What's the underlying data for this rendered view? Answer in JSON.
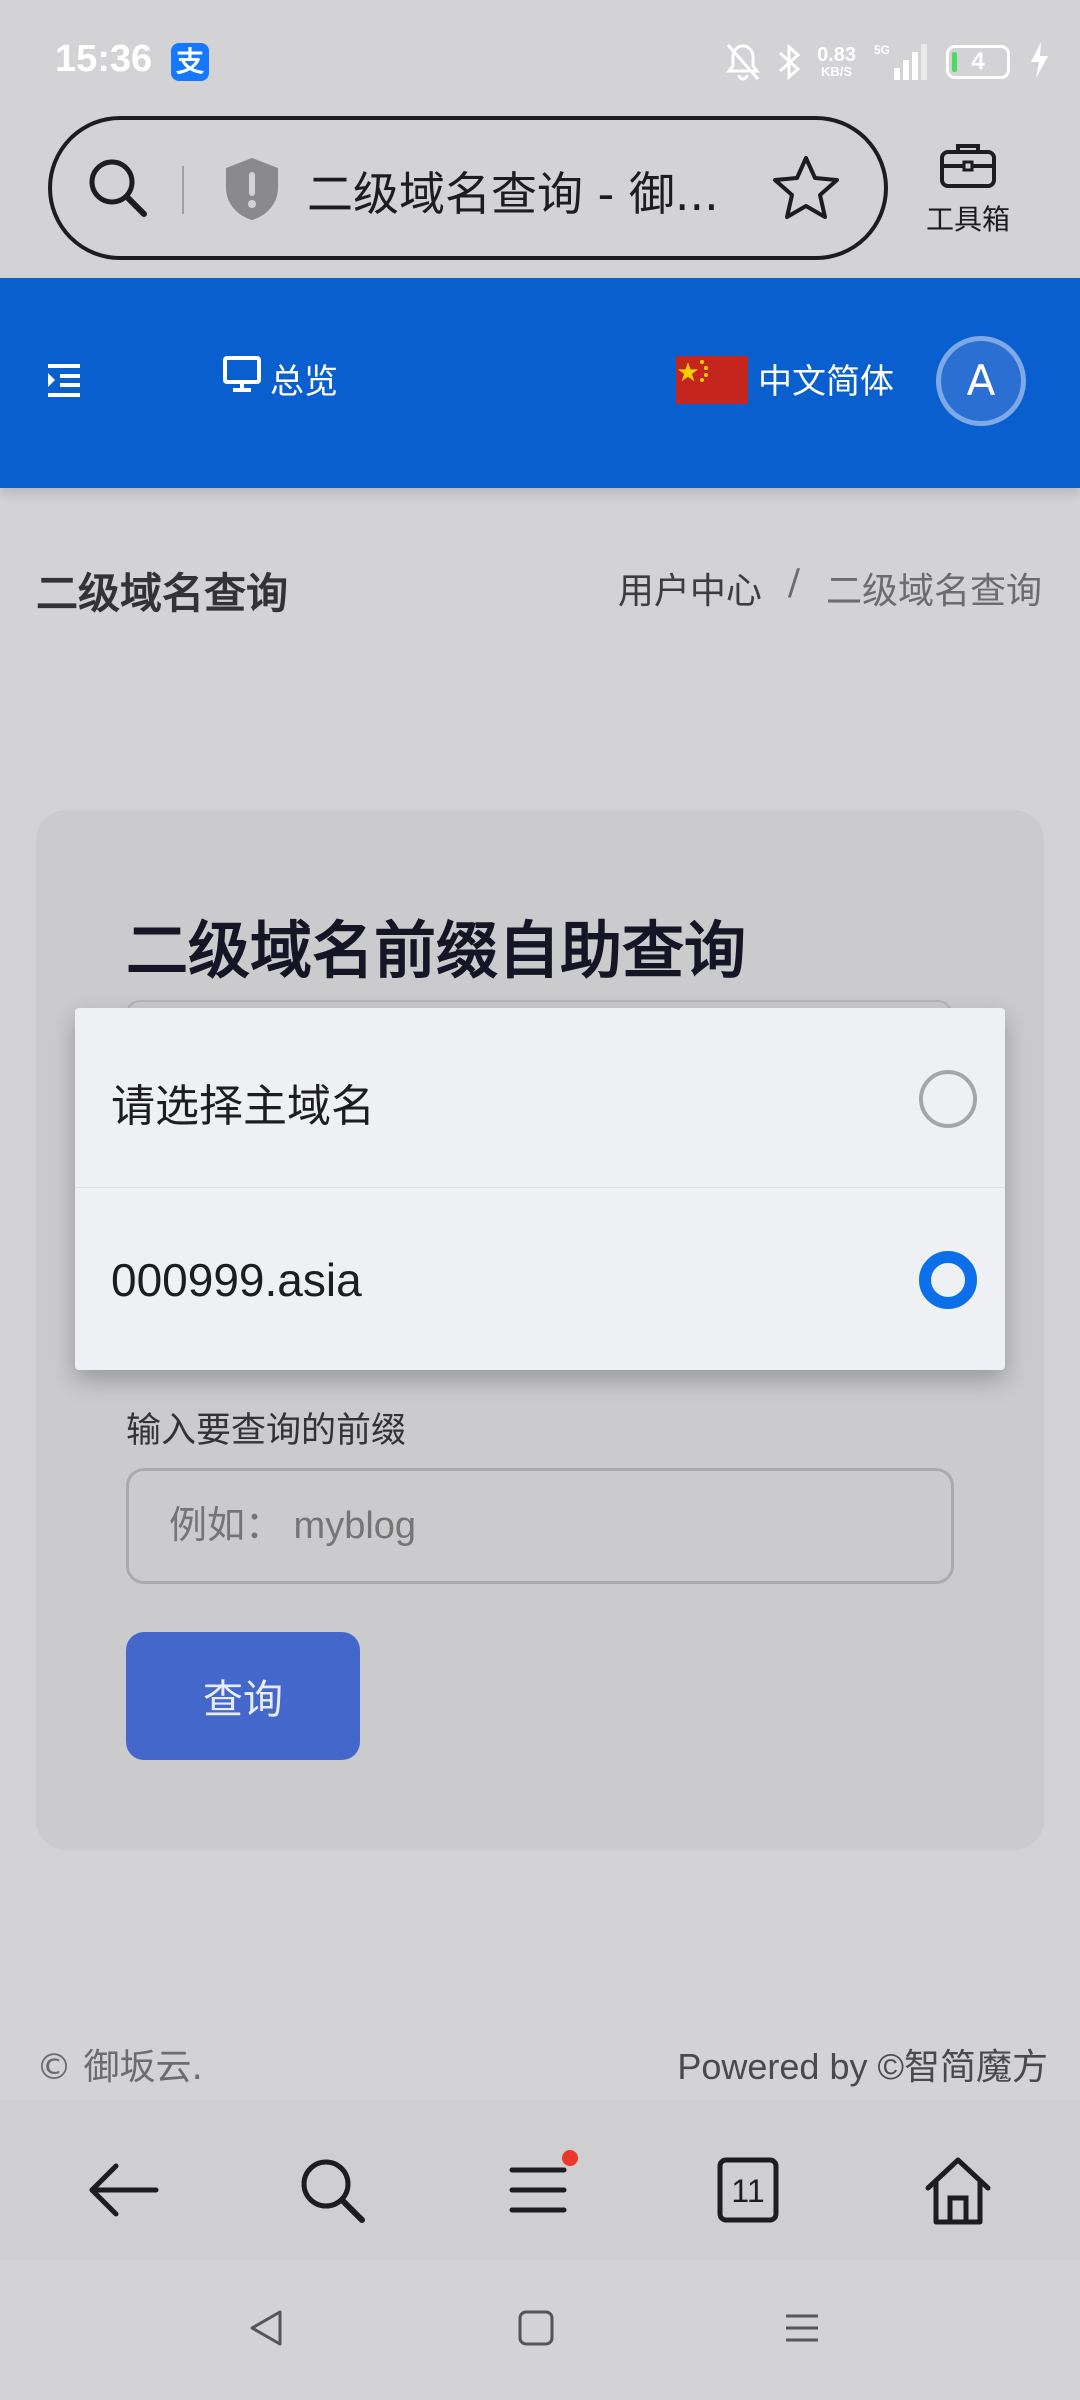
{
  "status_bar": {
    "time": "15:36",
    "app_badge": "支",
    "net_speed_value": "0.83",
    "net_speed_unit": "KB/S",
    "signal_label": "5G",
    "battery_level": "4"
  },
  "browser": {
    "url_title": "二级域名查询 - 御...",
    "toolbox_label": "工具箱",
    "tab_count": "11"
  },
  "header": {
    "overview_label": "总览",
    "language_label": "中文简体",
    "avatar_initial": "A"
  },
  "page": {
    "title": "二级域名查询",
    "breadcrumb": {
      "home": "用户中心",
      "separator": "/",
      "current": "二级域名查询"
    }
  },
  "card": {
    "title": "二级域名前缀自助查询",
    "prefix_label": "输入要查询的前缀",
    "prefix_placeholder": "例如： myblog",
    "submit_label": "查询"
  },
  "domain_picker": {
    "options": [
      {
        "label": "请选择主域名",
        "selected": false
      },
      {
        "label": "000999.asia",
        "selected": true
      }
    ]
  },
  "footer": {
    "copyright": "© 御坂云.",
    "powered_by": "Powered by ©智简魔方"
  },
  "colors": {
    "header_blue": "#0a5fcf",
    "button_blue": "#4467cb",
    "radio_selected": "#0a6fe8"
  }
}
